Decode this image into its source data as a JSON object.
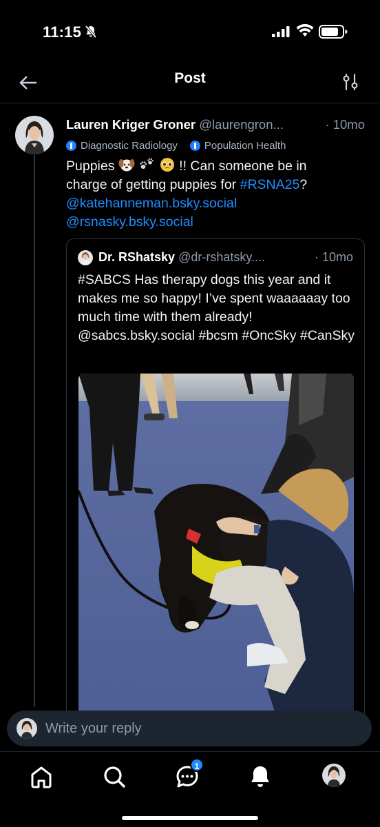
{
  "status_bar": {
    "time": "11:15"
  },
  "header": {
    "title": "Post"
  },
  "post": {
    "author_name": "Lauren Kriger Groner",
    "author_handle": "@laurengron...",
    "time": "· 10mo",
    "labels": [
      "Diagnostic Radiology",
      "Population Health"
    ],
    "text_line1": "Puppies",
    "text_line1_end": "!! Can someone be in",
    "text_line2": "charge of getting puppies for",
    "hashtag": "#RSNA25",
    "text_line2_end": "?",
    "mention1": "@katehanneman.bsky.social",
    "mention2": "@rsnasky.bsky.social"
  },
  "quote": {
    "author_name": "Dr. RShatsky",
    "author_handle": "@dr-rshatsky....",
    "time": "· 10mo",
    "text": "#SABCS Has therapy dogs this year and it makes me so happy! I’ve spent waaaaaay too much time with them already! @sabcs.bsky.social #bcsm #OncSky #CanSky"
  },
  "reply": {
    "placeholder": "Write your reply"
  },
  "nav": {
    "chat_badge": "1"
  },
  "colors": {
    "accent": "#208bfe",
    "background": "#000000",
    "muted": "#8e9bab"
  }
}
